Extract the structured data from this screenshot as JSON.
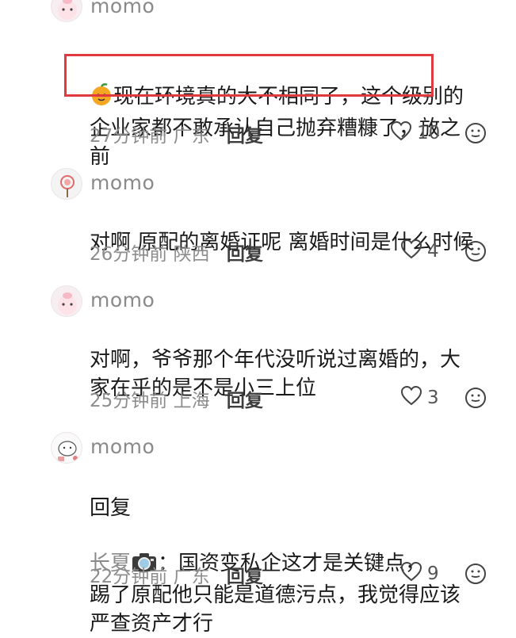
{
  "comments": [
    {
      "username": "momo",
      "content": "现在环境真的大不相同了，这个级别的\n企业家都不敢承认自己抛弃糟糠了，放之\n前",
      "time": "27分钟前",
      "location": "广东",
      "reply_label": "回复",
      "likes": "10"
    },
    {
      "username": "momo",
      "content": "对啊 原配的离婚证呢 离婚时间是什么时候",
      "time": "26分钟前",
      "location": "陕西",
      "reply_label": "回复",
      "likes": "4"
    },
    {
      "username": "momo",
      "content": "对啊，爷爷那个年代没听说过离婚的，大\n家在乎的是不是小三上位",
      "time": "25分钟前",
      "location": "上海",
      "reply_label": "回复",
      "likes": "3"
    },
    {
      "username": "momo",
      "reply_prefix": "回复",
      "reply_to": "长夏",
      "content": "：国资变私企这才是关键点，\n踢了原配他只能是道德污点，我觉得应该\n严查资产才行",
      "time": "22分钟前",
      "location": "广东",
      "reply_label": "回复",
      "likes": "9"
    }
  ],
  "icons": {
    "like": "heart-outline-icon",
    "emoji": "smiley-outline-icon",
    "inline_emoji_1": "orange-face-emoji",
    "inline_emoji_4": "camera-emoji"
  },
  "colors": {
    "highlight_box": "#e03a3f",
    "username": "#8a8a8a",
    "meta": "#8d8d8d"
  }
}
